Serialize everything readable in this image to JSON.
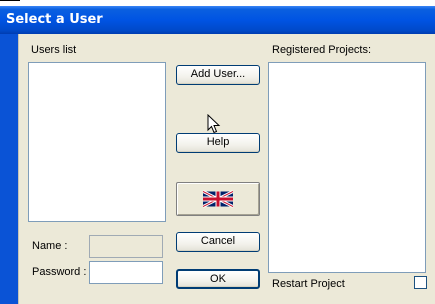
{
  "window": {
    "title": "Select a User"
  },
  "users_panel": {
    "label": "Users list",
    "items": []
  },
  "projects_panel": {
    "label": "Registered Projects:",
    "items": []
  },
  "fields": {
    "name_label": "Name :",
    "name_value": "",
    "password_label": "Password :",
    "password_value": ""
  },
  "buttons": {
    "add_user": "Add User...",
    "help": "Help",
    "language_icon": "uk-flag-icon",
    "cancel": "Cancel",
    "ok": "OK"
  },
  "restart": {
    "label": "Restart Project",
    "checked": false
  },
  "colors": {
    "title_bar": "#0054e3",
    "dialog_bg": "#ece9d8",
    "border": "#7f9db9"
  }
}
